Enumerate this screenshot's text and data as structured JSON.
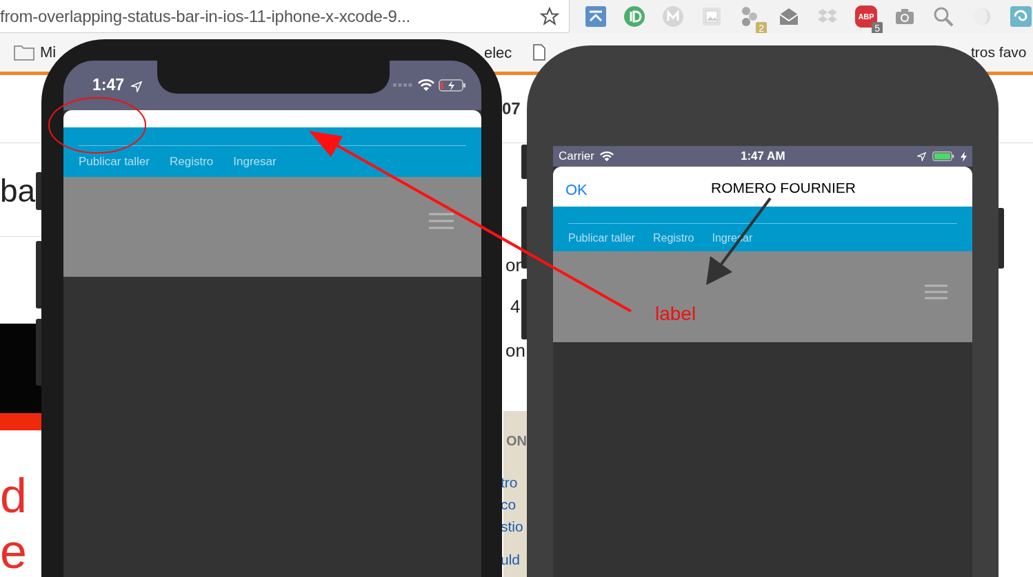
{
  "browser": {
    "url": "from-overlapping-status-bar-in-ios-11-iphone-x-xcode-9...",
    "extension_badges": [
      "2",
      "5"
    ],
    "adblock_text": "ABP",
    "bookmarks": [
      "Mi",
      "elec",
      "tros favo"
    ]
  },
  "background_page": {
    "heading_fragment": "07",
    "left_fragments": [
      "ba",
      "d",
      "e"
    ],
    "right_fragments": [
      "or",
      "4",
      "on"
    ],
    "panel_title": "ON",
    "panel_links": [
      "tro",
      "co",
      "stio",
      "uld"
    ]
  },
  "phone_left": {
    "status_time": "1:47",
    "battery_low": true,
    "nav_links": [
      "Publicar taller",
      "Registro",
      "Ingresar"
    ]
  },
  "phone_right": {
    "carrier": "Carrier",
    "status_time": "1:47 AM",
    "battery_low": false,
    "done_button": "OK",
    "title": "ROMERO FOURNIER",
    "nav_links": [
      "Publicar taller",
      "Registro",
      "Ingresar"
    ]
  },
  "annotation": {
    "label": "label"
  }
}
